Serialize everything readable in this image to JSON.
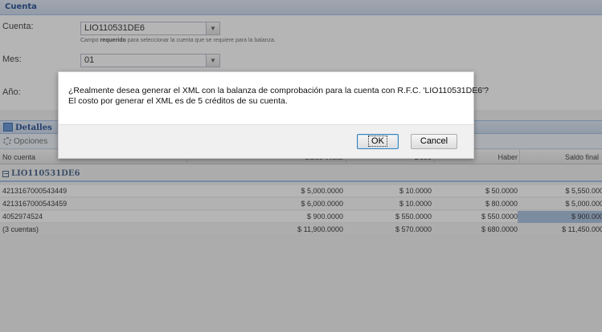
{
  "panel": {
    "title": "Cuenta"
  },
  "form": {
    "cuenta_label": "Cuenta:",
    "cuenta_value": "LIO110531DE6",
    "cuenta_hint_prefix": "Campo ",
    "cuenta_hint_bold": "requerido",
    "cuenta_hint_suffix": " para seleccionar la cuenta que se requiere para la balanza.",
    "mes_label": "Mes:",
    "mes_value": "01",
    "anio_label": "Año:"
  },
  "details": {
    "title": "Detalles",
    "toolbar_options": "Opciones"
  },
  "grid": {
    "columns": [
      "No cuenta",
      "Saldo inicial",
      "Debe",
      "Haber",
      "Saldo final"
    ],
    "group_label": "LIO110531DE6",
    "rows": [
      {
        "cuenta": "4213167000543449",
        "saldo_inicial": "$ 5,000.0000",
        "debe": "$ 10.0000",
        "haber": "$ 50.0000",
        "saldo_final": "$ 5,550.000"
      },
      {
        "cuenta": "4213167000543459",
        "saldo_inicial": "$ 6,000.0000",
        "debe": "$ 10.0000",
        "haber": "$ 80.0000",
        "saldo_final": "$ 5,000.000"
      },
      {
        "cuenta": "4052974524",
        "saldo_inicial": "$ 900.0000",
        "debe": "$ 550.0000",
        "haber": "$ 550.0000",
        "saldo_final": "$ 900.000"
      }
    ],
    "summary": {
      "cuenta": "(3 cuentas)",
      "saldo_inicial": "$ 11,900.0000",
      "debe": "$ 570.0000",
      "haber": "$ 680.0000",
      "saldo_final": "$ 11,450.000"
    }
  },
  "dialog": {
    "message_line1": "¿Realmente desea generar el XML con la balanza de comprobación para la cuenta con R.F.C. 'LIO110531DE6'?",
    "message_line2": "El costo por generar el XML es de 5 créditos de su cuenta.",
    "ok_label": "OK",
    "cancel_label": "Cancel"
  },
  "colors": {
    "header_text": "#15428b",
    "selected_cell": "#a4bddd",
    "mask": "#3c3c3c"
  }
}
